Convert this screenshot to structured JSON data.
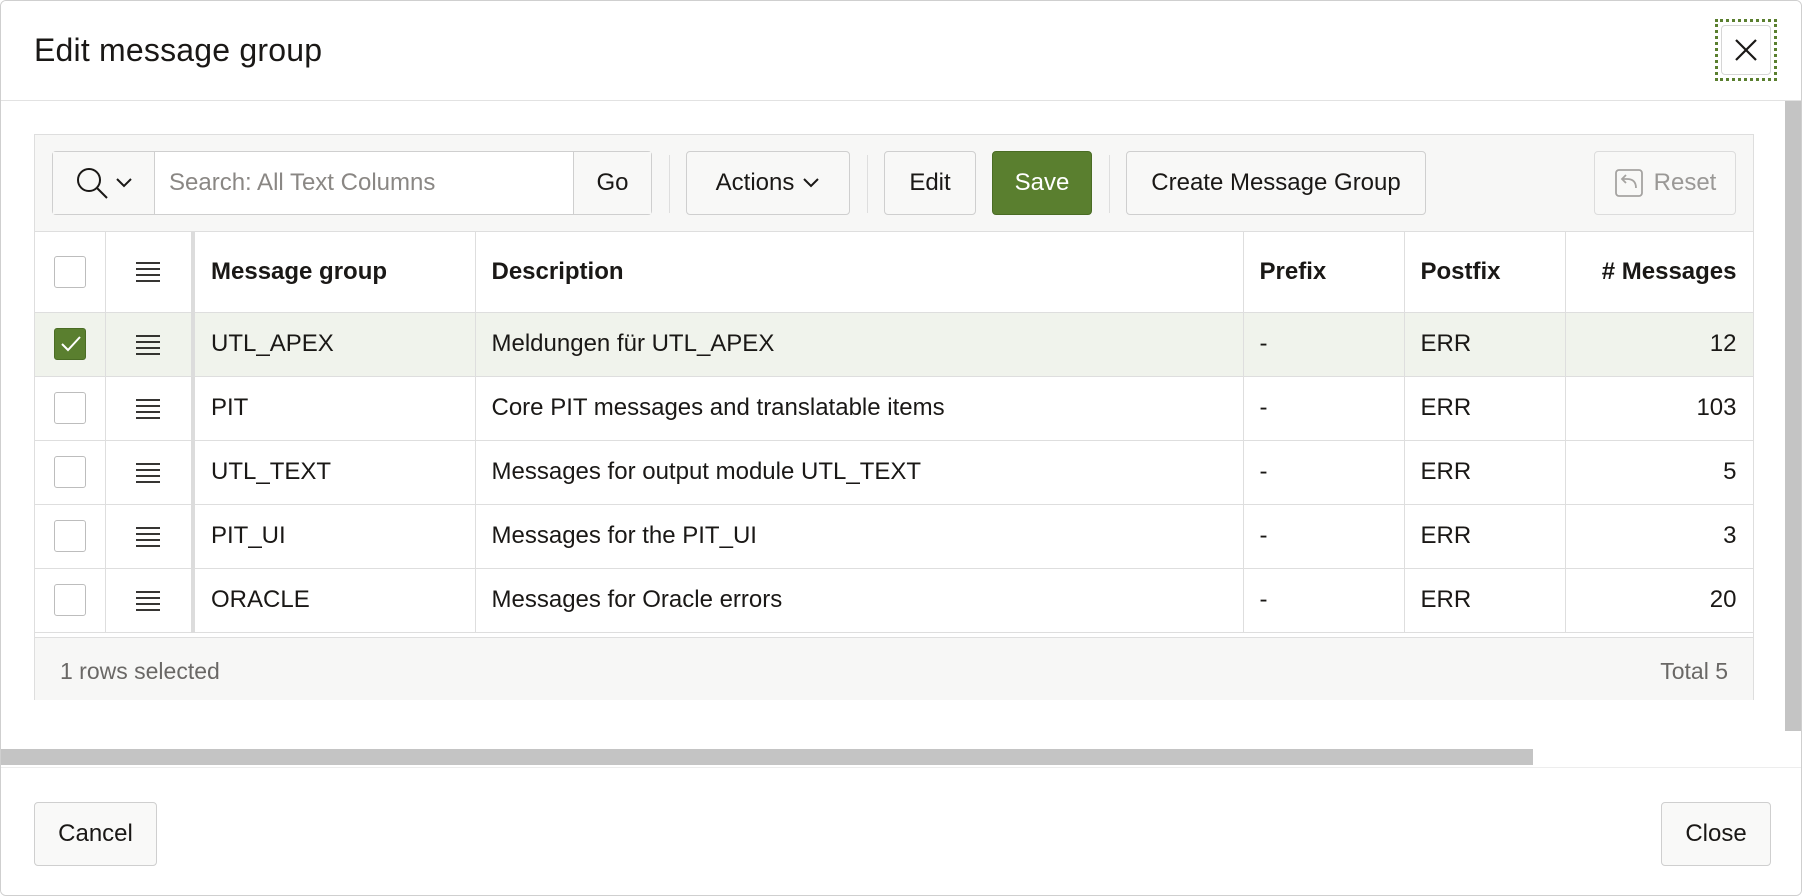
{
  "dialog": {
    "title": "Edit message group",
    "close_icon": "close-icon"
  },
  "toolbar": {
    "search_placeholder": "Search: All Text Columns",
    "search_value": "",
    "go_label": "Go",
    "actions_label": "Actions",
    "edit_label": "Edit",
    "save_label": "Save",
    "create_label": "Create Message Group",
    "reset_label": "Reset"
  },
  "grid": {
    "columns": [
      "Message group",
      "Description",
      "Prefix",
      "Postfix",
      "# Messages"
    ],
    "rows": [
      {
        "selected": true,
        "group": "UTL_APEX",
        "description": "Meldungen für UTL_APEX",
        "prefix": "-",
        "postfix": "ERR",
        "messages": "12"
      },
      {
        "selected": false,
        "group": "PIT",
        "description": "Core PIT messages and translatable items",
        "prefix": "-",
        "postfix": "ERR",
        "messages": "103"
      },
      {
        "selected": false,
        "group": "UTL_TEXT",
        "description": "Messages for output module UTL_TEXT",
        "prefix": "-",
        "postfix": "ERR",
        "messages": "5"
      },
      {
        "selected": false,
        "group": "PIT_UI",
        "description": "Messages for the PIT_UI",
        "prefix": "-",
        "postfix": "ERR",
        "messages": "3"
      },
      {
        "selected": false,
        "group": "ORACLE",
        "description": "Messages for Oracle errors",
        "prefix": "-",
        "postfix": "ERR",
        "messages": "20"
      }
    ],
    "footer_selected": "1 rows selected",
    "footer_total": "Total 5"
  },
  "footer": {
    "cancel_label": "Cancel",
    "close_label": "Close"
  },
  "colors": {
    "accent": "#5a7f2f",
    "selected_row": "#f0f3ec"
  }
}
